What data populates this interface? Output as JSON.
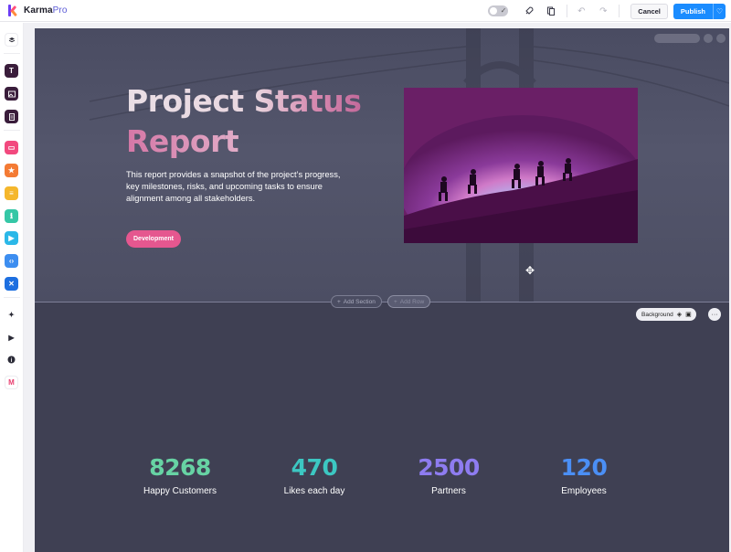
{
  "app": {
    "brand": "Karma",
    "brand_suffix": "Pro"
  },
  "toolbar": {
    "cancel_label": "Cancel",
    "publish_label": "Publish"
  },
  "sidebar_tools": [
    "layers-icon",
    "text-icon",
    "image-icon",
    "page-icon",
    "video-icon",
    "star-icon",
    "list-icon",
    "info-icon",
    "play-icon",
    "code-icon",
    "app-icon",
    "ai-sparkle-icon",
    "preview-icon",
    "help-icon",
    "m-icon"
  ],
  "hero": {
    "title_line1": "Project Status",
    "title_line2": "Report",
    "description": "This report provides a snapshot of the project’s progress, key milestones, risks, and upcoming tasks to ensure alignment among all stakeholders.",
    "tag_label": "Development"
  },
  "editor": {
    "add_section_label": "Add Section",
    "add_row_label": "Add Row",
    "background_label": "Background"
  },
  "stats": [
    {
      "value": "8268",
      "label": "Happy Customers",
      "color": "#67d3a4"
    },
    {
      "value": "470",
      "label": "Likes each day",
      "color": "#3cc7c2"
    },
    {
      "value": "2500",
      "label": "Partners",
      "color": "#8e7cf0"
    },
    {
      "value": "120",
      "label": "Employees",
      "color": "#4b8ff5"
    }
  ],
  "colors": {
    "publish": "#1a8cff",
    "tag": "#e5578f",
    "page_bg": "#3f4053"
  }
}
